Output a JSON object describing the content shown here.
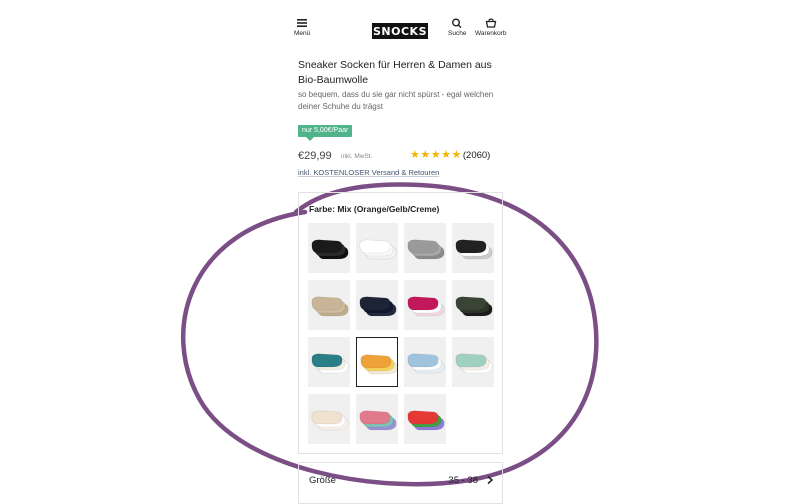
{
  "header": {
    "menu_label": "Menü",
    "logo": "SNOCKS",
    "search_label": "Suche",
    "cart_label": "Warenkorb"
  },
  "product": {
    "title": "Sneaker Socken für Herren & Damen aus Bio-Baumwolle",
    "subtitle": "so bequem, dass du sie gar nicht spürst - egal welchen deiner Schuhe du trägst",
    "badge": "nur 5,00€/Paar",
    "price": "€29,99",
    "vat": "inkl. MwSt.",
    "rating": 5,
    "review_count": "(2060)",
    "shipping": "inkl. KOSTENLOSER Versand & Retouren"
  },
  "color": {
    "label": "Farbe: Mix (Orange/Gelb/Creme)",
    "swatches": [
      {
        "name": "schwarz",
        "colors": [
          "#1a1a1a",
          "#2a2a2a",
          "#111111"
        ]
      },
      {
        "name": "weiss",
        "colors": [
          "#ffffff",
          "#fafafa",
          "#f4f4f4"
        ]
      },
      {
        "name": "grau",
        "colors": [
          "#9a9a9a",
          "#a8a8a8",
          "#8c8c8c"
        ]
      },
      {
        "name": "mix-schwarz-weiss-grau",
        "colors": [
          "#222222",
          "#ffffff",
          "#cccccc"
        ]
      },
      {
        "name": "beige",
        "colors": [
          "#c8b597",
          "#cfbd9f",
          "#c0ab8b"
        ]
      },
      {
        "name": "navy",
        "colors": [
          "#1d2438",
          "#141a2b",
          "#222b42"
        ]
      },
      {
        "name": "mix-pink-weiss",
        "colors": [
          "#c2185b",
          "#ffffff",
          "#f0d7e0"
        ]
      },
      {
        "name": "dunkelgruen",
        "colors": [
          "#3a4435",
          "#2d3529",
          "#1c1c1c"
        ]
      },
      {
        "name": "mix-tuerkis-creme",
        "colors": [
          "#2a7e86",
          "#f3eee3",
          "#ffffff"
        ]
      },
      {
        "name": "mix-orange-gelb-creme",
        "colors": [
          "#f0a23a",
          "#f4d35e",
          "#f3ead8"
        ]
      },
      {
        "name": "mix-blau-weiss",
        "colors": [
          "#9fc4de",
          "#ffffff",
          "#e6eef5"
        ]
      },
      {
        "name": "mix-mint-creme",
        "colors": [
          "#9fd0c0",
          "#f4efe6",
          "#ffffff"
        ]
      },
      {
        "name": "mix-creme-weiss",
        "colors": [
          "#efe3cf",
          "#ffffff",
          "#f7f2ea"
        ]
      },
      {
        "name": "mix-pastell",
        "colors": [
          "#e07a8a",
          "#7fc2b8",
          "#9b8fd6"
        ]
      },
      {
        "name": "mix-regenbogen",
        "colors": [
          "#e53935",
          "#43a047",
          "#8e7be0"
        ]
      }
    ],
    "selected_index": 9,
    "annotation_color": "#7b4f86"
  },
  "size": {
    "label": "Größe",
    "value": "35 - 38"
  }
}
